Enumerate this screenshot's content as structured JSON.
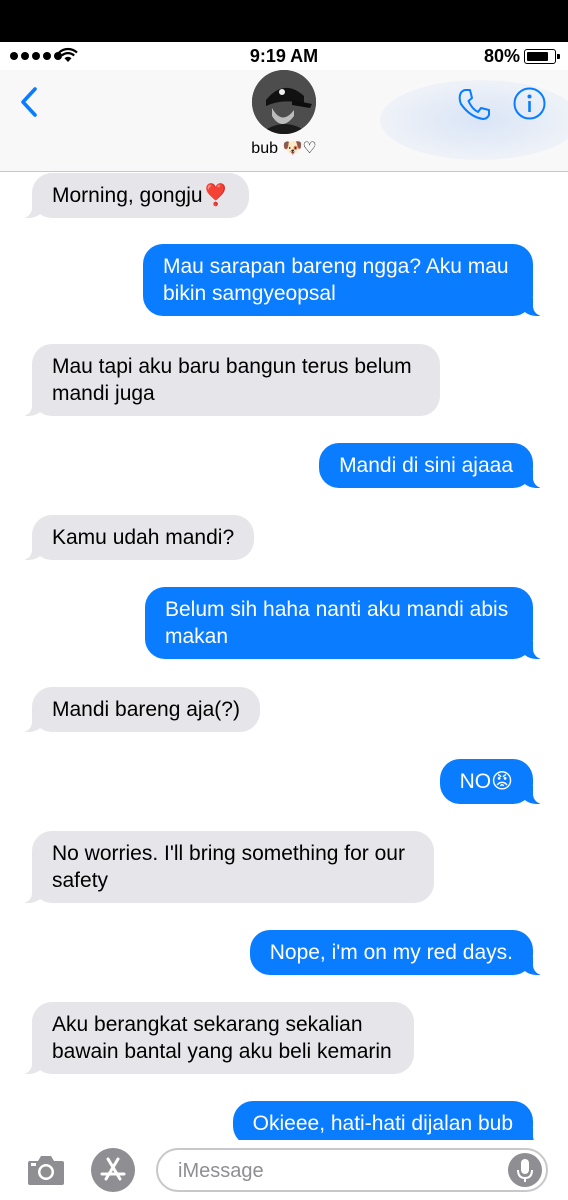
{
  "status_bar": {
    "time": "9:19 AM",
    "battery": "80%",
    "battery_level": 0.8
  },
  "header": {
    "contact_name": "bub 🐶♡"
  },
  "messages": [
    {
      "side": "in",
      "text": "Morning, gongju❣️"
    },
    {
      "side": "out",
      "text": "Mau sarapan bareng ngga? Aku mau\nbikin samgyeopsal"
    },
    {
      "side": "in",
      "text": "Mau tapi aku baru bangun terus belum\nmandi juga"
    },
    {
      "side": "out",
      "text": "Mandi di sini ajaaa"
    },
    {
      "side": "in",
      "text": "Kamu udah mandi?"
    },
    {
      "side": "out",
      "text": "Belum sih haha nanti aku mandi abis\nmakan"
    },
    {
      "side": "in",
      "text": "Mandi bareng aja(?)"
    },
    {
      "side": "out",
      "text": "NO😡"
    },
    {
      "side": "in",
      "text": "No worries. I'll bring something for our\nsafety"
    },
    {
      "side": "out",
      "text": "Nope, i'm on my red days."
    },
    {
      "side": "in",
      "text": "Aku berangkat sekarang sekalian\nbawain bantal yang aku beli kemarin"
    },
    {
      "side": "out",
      "text": "Okieee, hati-hati dijalan bub"
    }
  ],
  "composer": {
    "placeholder": "iMessage"
  },
  "icons": {
    "back": "chevron-left-icon",
    "call": "phone-icon",
    "details": "info-icon",
    "camera": "camera-icon",
    "apps": "app-store-icon",
    "dictation": "microphone-icon"
  },
  "colors": {
    "accent": "#0a7cff",
    "incoming_bubble": "#e5e5ea",
    "icon_gray": "#8e8e93"
  }
}
